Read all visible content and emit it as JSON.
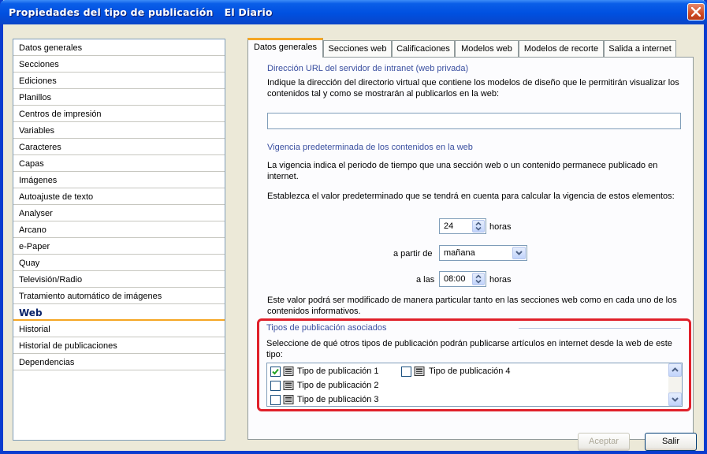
{
  "window": {
    "title": "Propiedades del tipo de publicación",
    "subtitle": "El Diario"
  },
  "sidebar": {
    "items": [
      {
        "label": "Datos generales"
      },
      {
        "label": "Secciones"
      },
      {
        "label": "Ediciones"
      },
      {
        "label": "Planillos"
      },
      {
        "label": "Centros de impresión"
      },
      {
        "label": "Variables"
      },
      {
        "label": "Caracteres"
      },
      {
        "label": "Capas"
      },
      {
        "label": "Imágenes"
      },
      {
        "label": "Autoajuste de texto"
      },
      {
        "label": "Analyser"
      },
      {
        "label": "Arcano"
      },
      {
        "label": "e-Paper"
      },
      {
        "label": "Quay"
      },
      {
        "label": "Televisión/Radio"
      },
      {
        "label": "Tratamiento automático de imágenes"
      },
      {
        "label": "Web",
        "selected": true
      },
      {
        "label": "Historial"
      },
      {
        "label": "Historial de publicaciones"
      },
      {
        "label": "Dependencias"
      }
    ]
  },
  "tabs": [
    {
      "label": "Datos generales",
      "active": true
    },
    {
      "label": "Secciones web"
    },
    {
      "label": "Calificaciones"
    },
    {
      "label": "Modelos web"
    },
    {
      "label": "Modelos de recorte"
    },
    {
      "label": "Salida a internet"
    }
  ],
  "url_section": {
    "title": "Dirección URL del servidor de intranet (web privada)",
    "desc_line1": "Indique la dirección del directorio virtual que contiene los modelos de diseño que le permitirán visualizar los",
    "desc_line2": "contenidos tal y como se mostrarán al publicarlos en la web:",
    "value": ""
  },
  "validity": {
    "title": "Vigencia predeterminada de los contenidos en la web",
    "desc_line1": "La vigencia indica el periodo de tiempo que una sección web o un contenido permanece publicado en",
    "desc_line2": "internet.",
    "default_text": "Establezca el valor predeterminado que se tendrá en cuenta para calcular la vigencia de estos elementos:",
    "hours_value": "24",
    "hours_unit": "horas",
    "from_label": "a partir de",
    "from_value": "mañana",
    "at_label": "a las",
    "at_value": "08:00",
    "at_unit": "horas",
    "note_line1": "Este valor podrá ser modificado de manera particular tanto en las secciones web como en cada uno de los",
    "note_line2": "contenidos informativos."
  },
  "associated": {
    "title": "Tipos de publicación asociados",
    "desc_line1": "Seleccione de qué otros tipos de publicación podrán publicarse artículos en internet desde la web de este",
    "desc_line2": "tipo:",
    "items": [
      {
        "label": "Tipo de publicación 1",
        "checked": true
      },
      {
        "label": "Tipo de publicación 2",
        "checked": false
      },
      {
        "label": "Tipo de publicación 3",
        "checked": false
      },
      {
        "label": "Tipo de publicación 4",
        "checked": false
      }
    ]
  },
  "footer": {
    "accept_label": "Aceptar",
    "exit_label": "Salir"
  },
  "colors": {
    "title_bar": "#0050e0",
    "selected_underline": "#f5a623",
    "highlight_frame": "#e0202a",
    "section_title": "#3a4fa0"
  }
}
